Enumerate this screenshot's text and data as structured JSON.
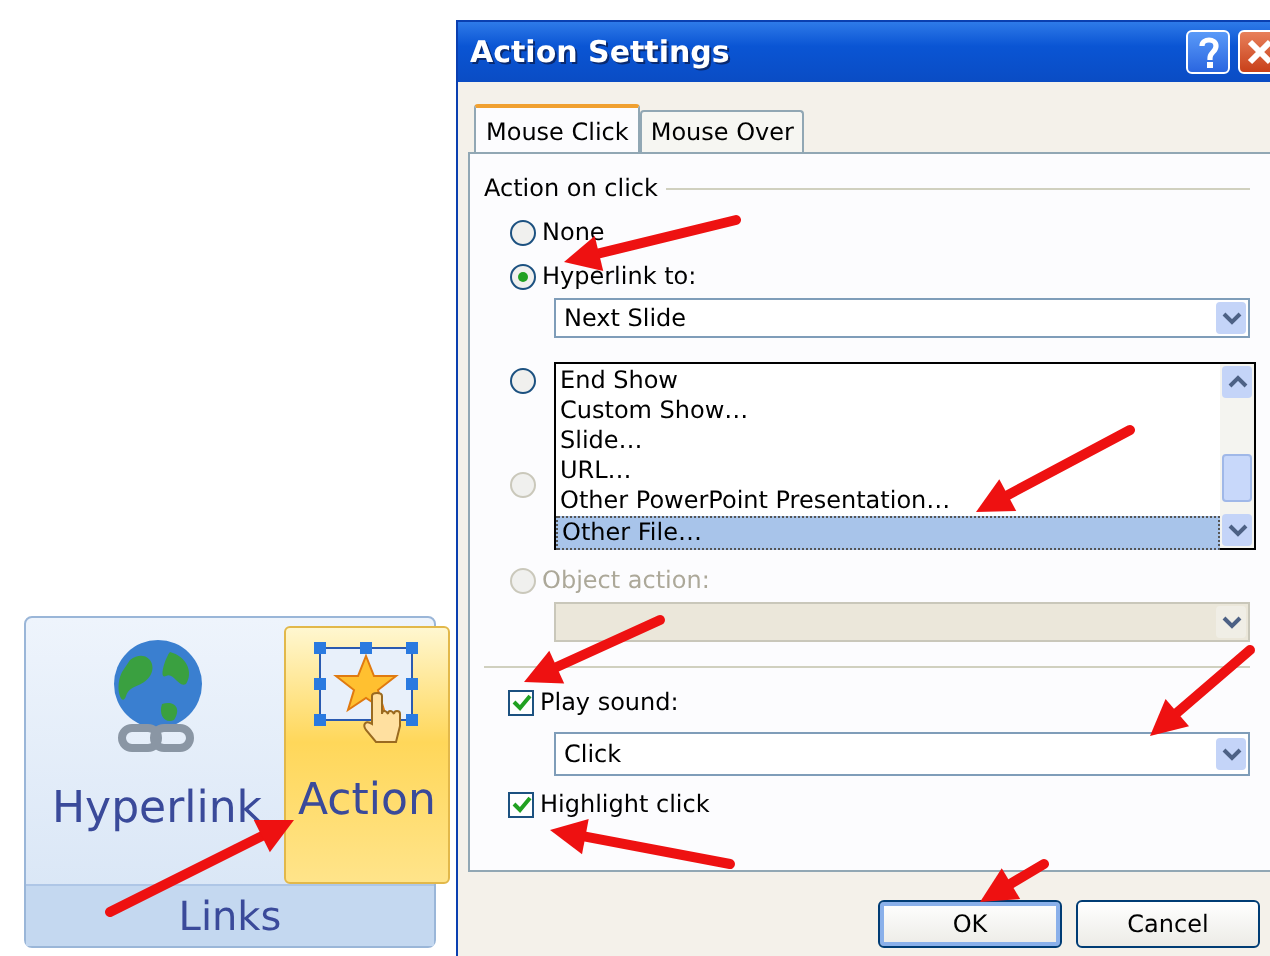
{
  "ribbon_group": {
    "label": "Links",
    "buttons": [
      {
        "label": "Hyperlink",
        "selected": false
      },
      {
        "label": "Action",
        "selected": true
      }
    ]
  },
  "window": {
    "title": "Action Settings"
  },
  "tabs": [
    {
      "label": "Mouse Click",
      "selected": true
    },
    {
      "label": "Mouse Over",
      "selected": false
    }
  ],
  "action_group": {
    "legend": "Action on click",
    "options": [
      {
        "label": "None",
        "selected": false,
        "disabled": false
      },
      {
        "label": "Hyperlink to:",
        "selected": true,
        "disabled": false,
        "field": {
          "value": "Next Slide",
          "disabled": false
        }
      },
      {
        "selected": false,
        "disabled": false
      },
      {
        "selected": false,
        "disabled": true
      },
      {
        "label": "Object action:",
        "selected": false,
        "disabled": true,
        "field": {
          "disabled": true
        }
      }
    ]
  },
  "dropdown_list": {
    "items": [
      {
        "label": "End Show",
        "selected": false
      },
      {
        "label": "Custom Show…",
        "selected": false
      },
      {
        "label": "Slide…",
        "selected": false
      },
      {
        "label": "URL…",
        "selected": false
      },
      {
        "label": "Other PowerPoint Presentation…",
        "selected": false
      },
      {
        "label": "Other File…",
        "selected": true
      }
    ]
  },
  "play_sound": {
    "label": "Play sound:",
    "checked": true,
    "field": {
      "value": "Click",
      "disabled": false
    }
  },
  "highlight_click": {
    "label": "Highlight click",
    "checked": true
  },
  "buttons": [
    {
      "label": "OK",
      "default": true
    },
    {
      "label": "Cancel",
      "default": false
    }
  ]
}
